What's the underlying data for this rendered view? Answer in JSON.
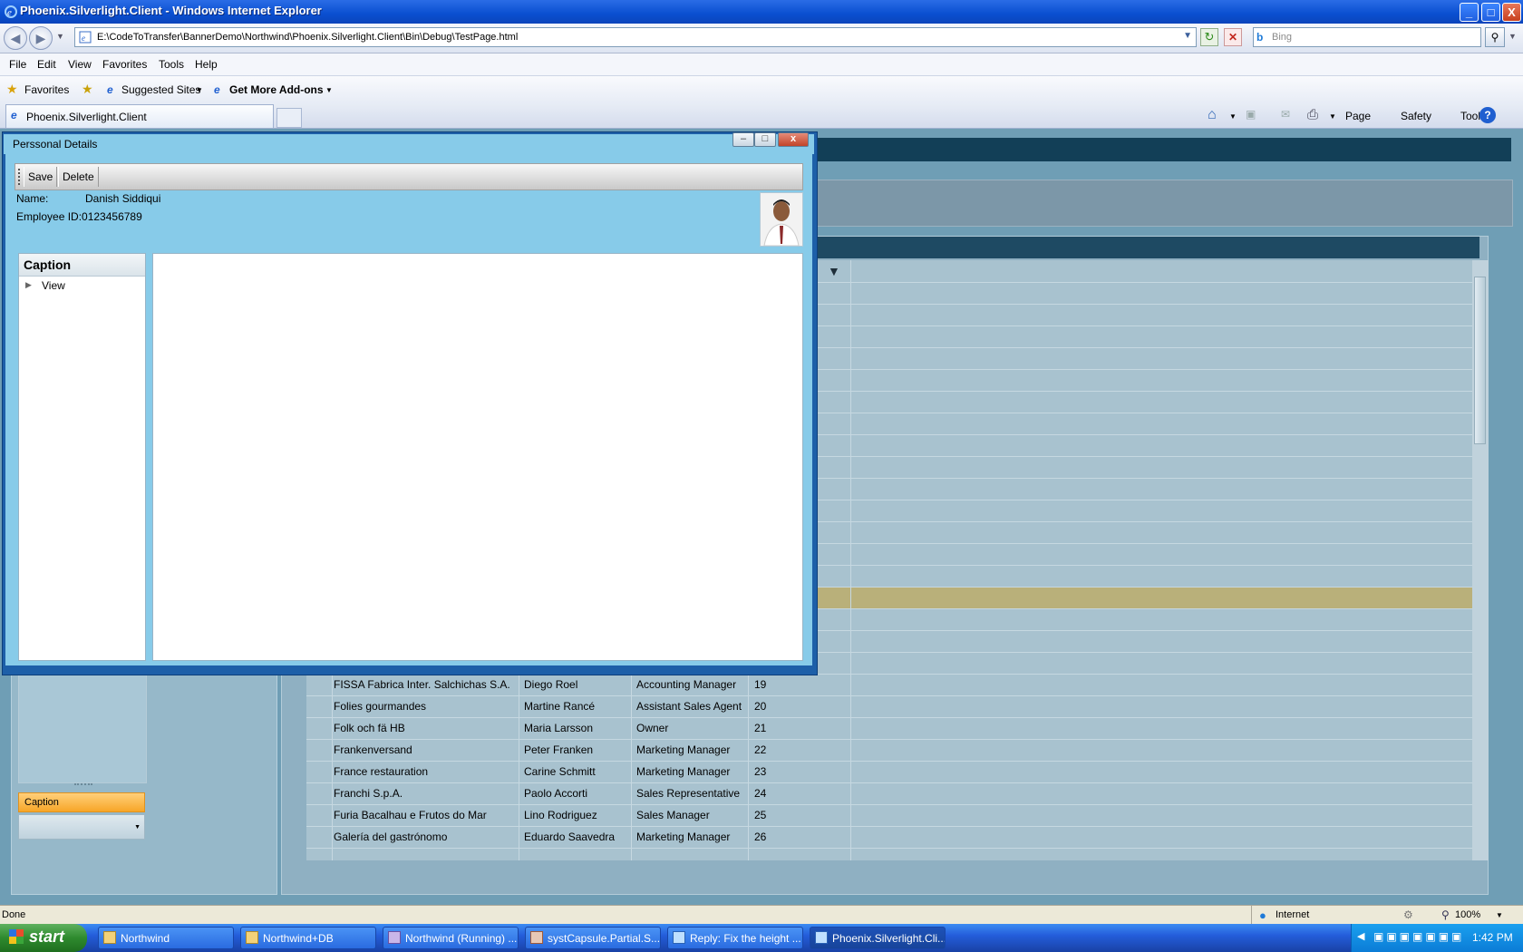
{
  "window": {
    "title": "Phoenix.Silverlight.Client - Windows Internet Explorer",
    "min": "_",
    "max": "□",
    "close": "X"
  },
  "address": {
    "url": "E:\\CodeToTransfer\\BannerDemo\\Northwind\\Phoenix.Silverlight.Client\\Bin\\Debug\\TestPage.html",
    "search_placeholder": "Bing"
  },
  "menu": [
    "File",
    "Edit",
    "View",
    "Favorites",
    "Tools",
    "Help"
  ],
  "favorites": {
    "favorites_label": "Favorites",
    "suggested": "Suggested Sites",
    "addons": "Get More Add-ons"
  },
  "tab": {
    "label": "Phoenix.Silverlight.Client"
  },
  "commandbar": {
    "page": "Page",
    "safety": "Safety",
    "tools": "Tools",
    "help": "?"
  },
  "dialog": {
    "title": "Perssonal Details",
    "toolbar": {
      "save": "Save",
      "delete": "Delete"
    },
    "name_label": "Name:",
    "name_value": "Danish Siddiqui",
    "employee_id": "Employee ID:0123456789",
    "tree_header": "Caption",
    "tree_item": "View"
  },
  "left_panel": {
    "caption": "Caption"
  },
  "grid": {
    "rows": [
      {
        "company": "FISSA Fabrica Inter. Salchichas S.A.",
        "contact": "Diego Roel",
        "title": "Accounting Manager",
        "id": "19"
      },
      {
        "company": "Folies gourmandes",
        "contact": "Martine Rancé",
        "title": "Assistant Sales Agent",
        "id": "20"
      },
      {
        "company": "Folk och fä HB",
        "contact": "Maria Larsson",
        "title": "Owner",
        "id": "21"
      },
      {
        "company": "Frankenversand",
        "contact": "Peter Franken",
        "title": "Marketing Manager",
        "id": "22"
      },
      {
        "company": "France restauration",
        "contact": "Carine Schmitt",
        "title": "Marketing Manager",
        "id": "23"
      },
      {
        "company": "Franchi S.p.A.",
        "contact": "Paolo Accorti",
        "title": "Sales Representative",
        "id": "24"
      },
      {
        "company": "Furia Bacalhau e Frutos do Mar",
        "contact": "Lino Rodriguez",
        "title": "Sales Manager",
        "id": "25"
      },
      {
        "company": "Galería del gastrónomo",
        "contact": "Eduardo Saavedra",
        "title": "Marketing Manager",
        "id": "26"
      }
    ]
  },
  "status": {
    "left": "Done",
    "zone": "Internet",
    "zoom": "100%"
  },
  "taskbar": {
    "start": "start",
    "tasks": [
      "Northwind",
      "Northwind+DB",
      "Northwind (Running) ...",
      "systCapsule.Partial.S...",
      "Reply: Fix the height ...",
      "Phoenix.Silverlight.Cli..."
    ],
    "clock": "1:42 PM"
  },
  "colors": {
    "accent": "#0a4fd0",
    "dialog_body": "#87cbe9",
    "highlight_row": "#b9b07a",
    "caption_orange": "#f7a628"
  }
}
